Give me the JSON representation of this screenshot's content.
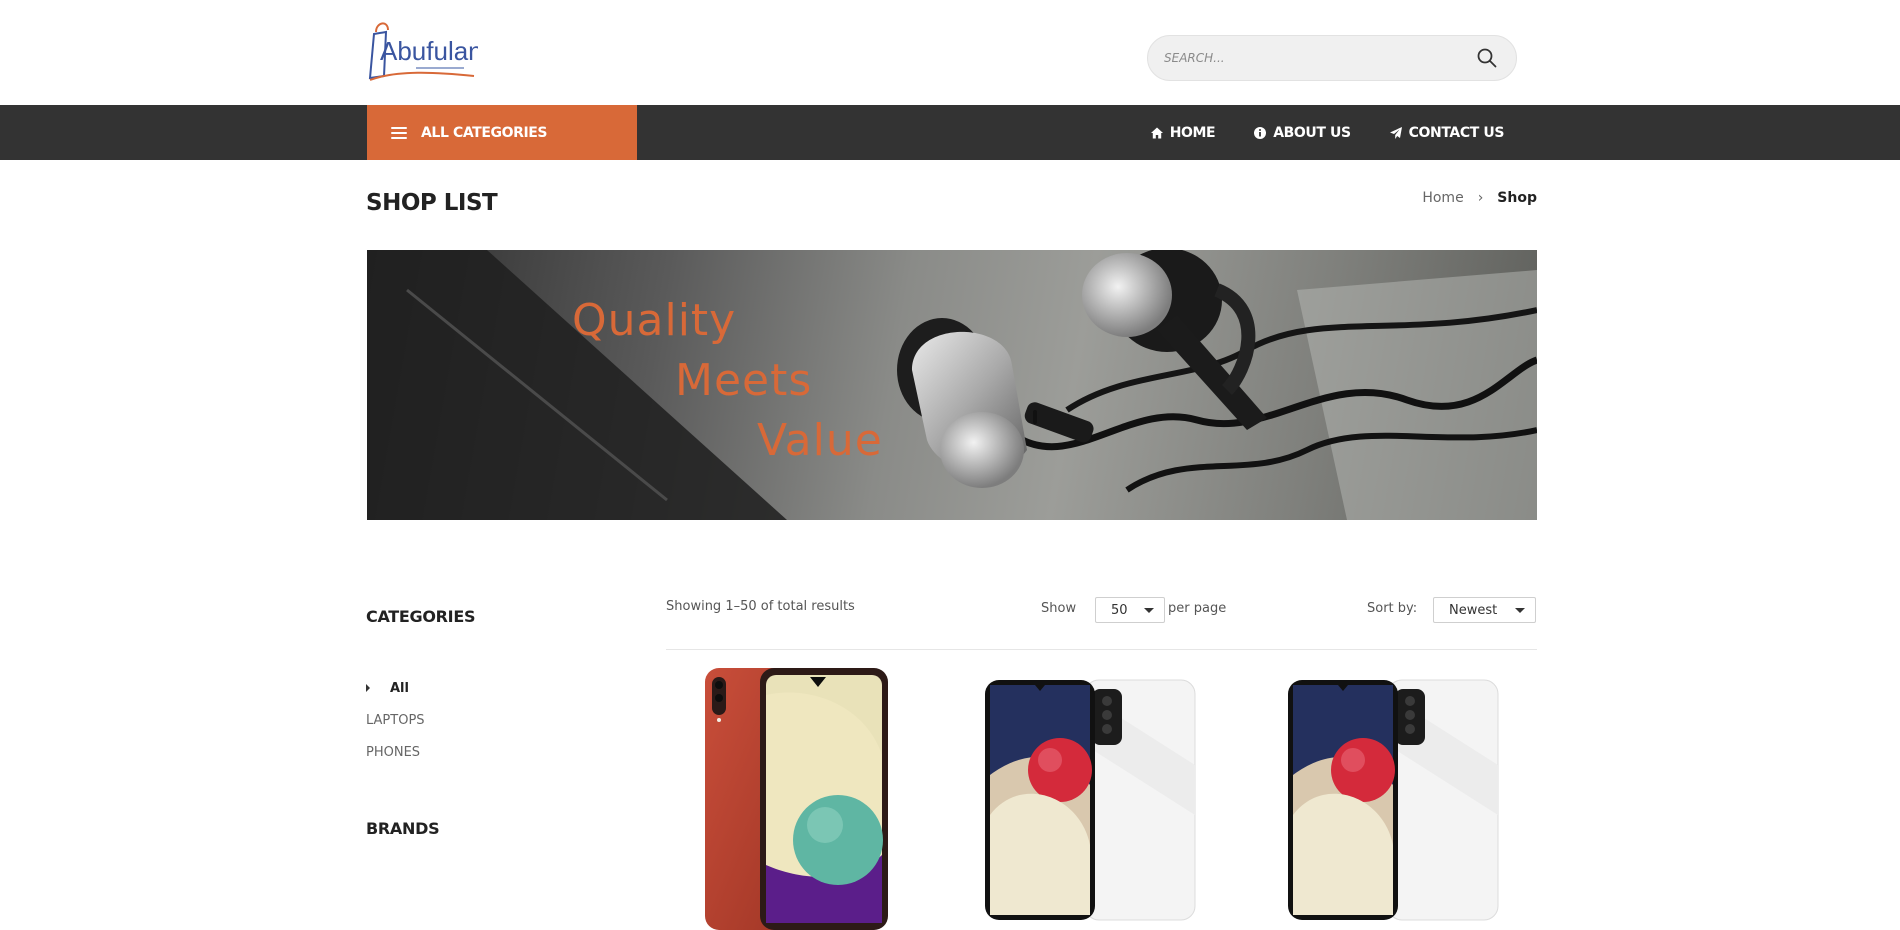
{
  "header": {
    "logo_text": "Abufulan",
    "search": {
      "placeholder": "SEARCH..."
    }
  },
  "nav": {
    "all_categories_label": "ALL CATEGORIES",
    "links": [
      {
        "label": "HOME",
        "icon": "home-icon"
      },
      {
        "label": "ABOUT US",
        "icon": "info-icon"
      },
      {
        "label": "CONTACT US",
        "icon": "paper-plane-icon"
      }
    ]
  },
  "page": {
    "title": "SHOP LIST",
    "breadcrumb": {
      "home": "Home",
      "current": "Shop"
    }
  },
  "banner": {
    "lines": [
      "Quality",
      "Meets",
      "Value"
    ]
  },
  "sidebar": {
    "categories_heading": "CATEGORIES",
    "categories": [
      {
        "label": "All",
        "active": true
      },
      {
        "label": "LAPTOPS",
        "active": false
      },
      {
        "label": "PHONES",
        "active": false
      }
    ],
    "brands_heading": "BRANDS"
  },
  "toolbar": {
    "result_text": "Showing 1–50 of total results",
    "show_label": "Show",
    "per_page_value": "50",
    "per_page_label": "per page",
    "sort_label": "Sort by:",
    "sort_value": "Newest"
  },
  "colors": {
    "accent": "#d86938",
    "navbar": "#333333",
    "text_dark": "#222222"
  },
  "products": [
    {
      "image": "red-phone-front-back"
    },
    {
      "image": "white-phone-front-back"
    },
    {
      "image": "white-phone-front-back"
    }
  ]
}
